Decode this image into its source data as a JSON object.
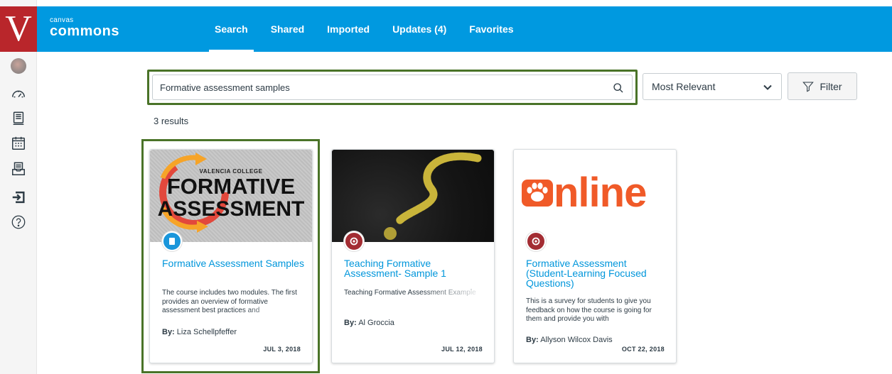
{
  "brand": {
    "small": "canvas",
    "big": "commons",
    "logo_letter": "V"
  },
  "nav_tabs": [
    {
      "label": "Search",
      "active": true
    },
    {
      "label": "Shared",
      "active": false
    },
    {
      "label": "Imported",
      "active": false
    },
    {
      "label": "Updates (4)",
      "active": false
    },
    {
      "label": "Favorites",
      "active": false
    }
  ],
  "left_nav_icons": [
    "avatar",
    "dashboard-icon",
    "courses-icon",
    "calendar-icon",
    "inbox-icon",
    "logout-icon",
    "help-icon"
  ],
  "search": {
    "value": "Formative assessment samples",
    "placeholder": "Search"
  },
  "sort": {
    "selected": "Most Relevant"
  },
  "filter": {
    "label": "Filter"
  },
  "results": {
    "count_text": "3 results"
  },
  "cards": [
    {
      "thumb_line1": "VALENCIA COLLEGE",
      "thumb_line2": "FORMATIVE",
      "thumb_line3": "ASSESSMENT",
      "type": "course",
      "title": "Formative Assessment Samples",
      "description": "The course includes two modules. The first provides an overview of formative assessment best practices and",
      "author_label": "By:",
      "author": "Liza Schellpfeffer",
      "date": "JUL 3, 2018"
    },
    {
      "type": "quiz",
      "title": "Teaching Formative Assessment- Sample 1",
      "description": "Teaching Formative Assessment Example",
      "author_label": "By:",
      "author": "Al Groccia",
      "date": "JUL 12, 2018"
    },
    {
      "thumb_text": "nline",
      "type": "quiz",
      "title": "Formative Assessment (Student-Learning Focused Questions)",
      "description": "This is a survey for students to give you feedback on how the course is going for them and provide you with",
      "author_label": "By:",
      "author": "Allyson Wilcox Davis",
      "date": "OCT 22, 2018"
    }
  ],
  "colors": {
    "header": "#0099e0",
    "logo": "#b9262b",
    "highlight": "#4a7328",
    "link": "#0096db",
    "course_badge": "#1a96db",
    "quiz_badge": "#a32d33",
    "online_orange": "#f05a28"
  }
}
